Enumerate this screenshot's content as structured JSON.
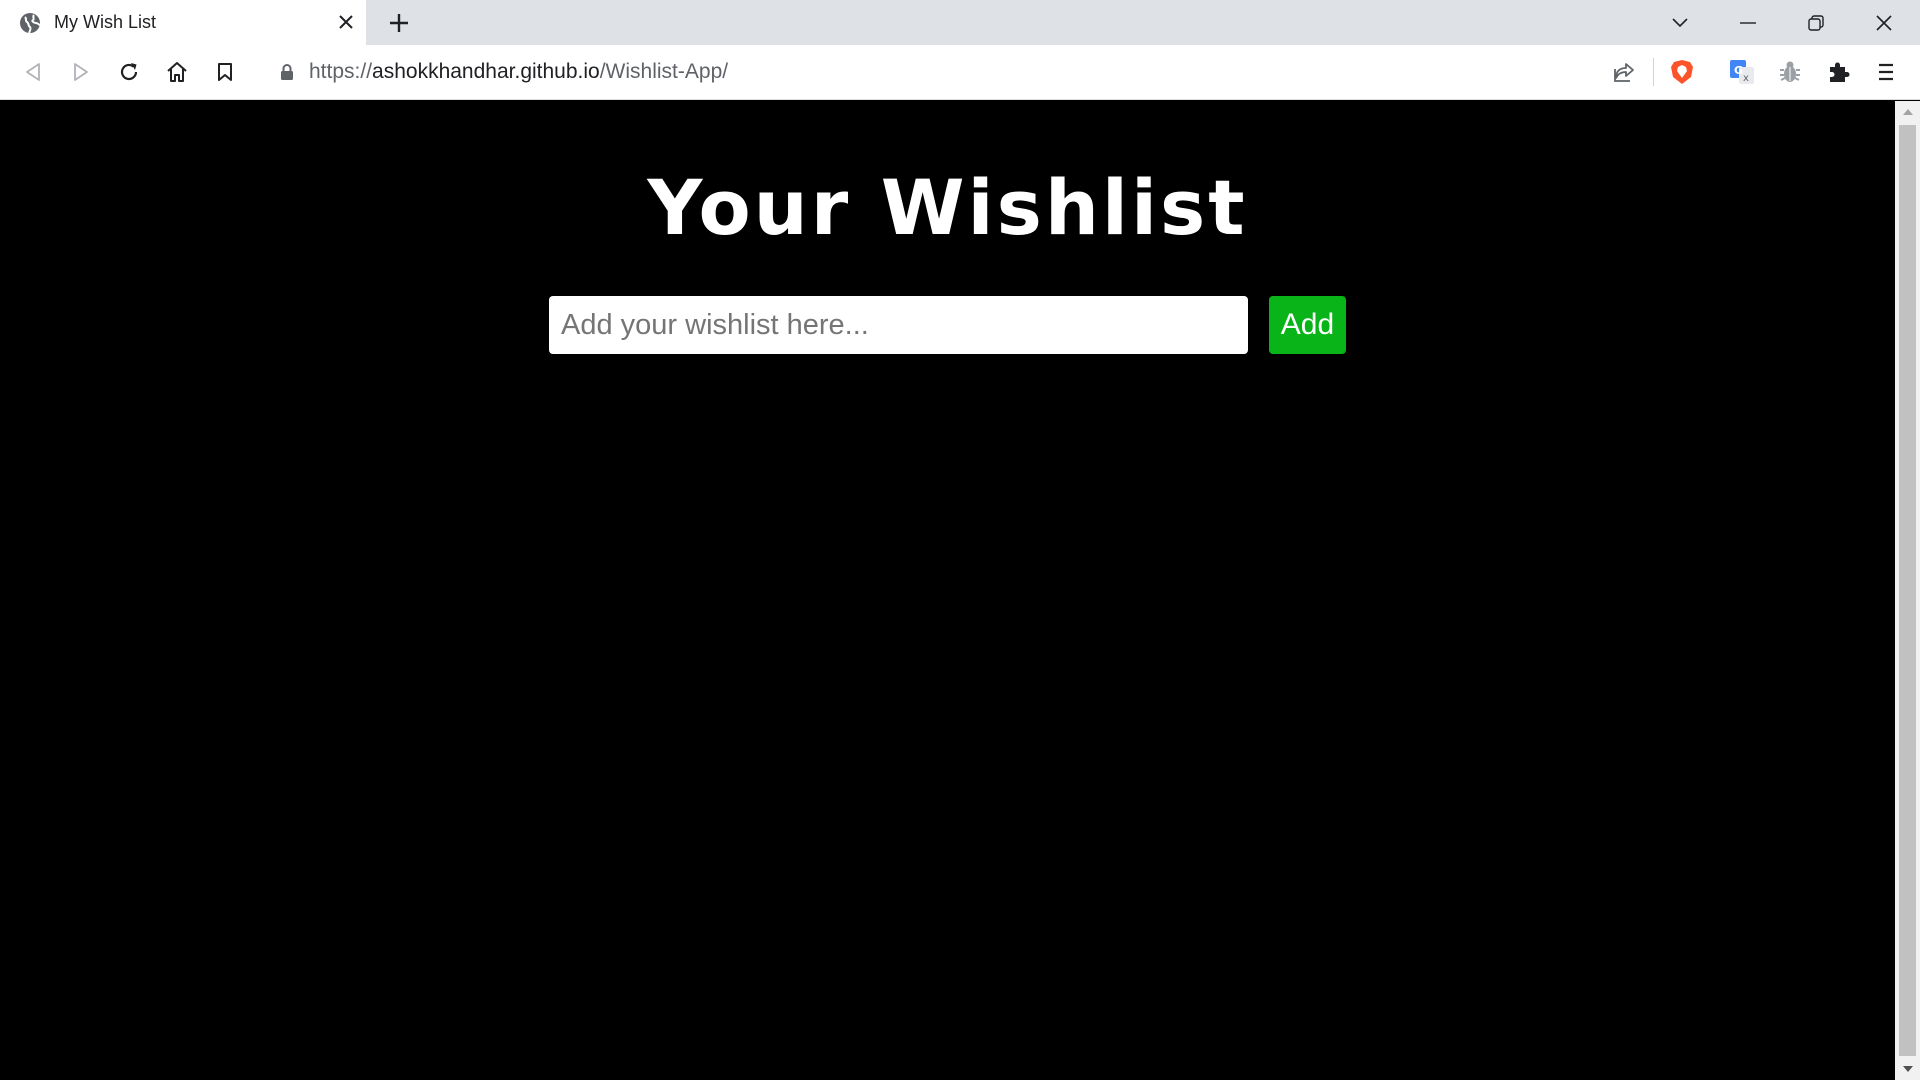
{
  "browser": {
    "tab": {
      "title": "My Wish List",
      "favicon": "globe-icon",
      "close_icon": "close-icon"
    },
    "new_tab_icon": "plus-icon",
    "window_controls": [
      "chevron-down-icon",
      "minimize-icon",
      "restore-icon",
      "close-icon"
    ],
    "toolbar": {
      "back_icon": "back-arrow-icon",
      "forward_icon": "forward-arrow-icon",
      "reload_icon": "reload-icon",
      "home_icon": "home-icon",
      "bookmark_icon": "bookmark-icon",
      "url_scheme": "https://",
      "url_host": "ashokkhandhar.github.io",
      "url_path": "/Wishlist-App/",
      "share_icon": "share-icon",
      "brave_icon": "brave-shield-icon",
      "extensions": [
        "translate-icon",
        "bug-icon",
        "puzzle-icon"
      ],
      "menu_icon": "hamburger-menu-icon"
    }
  },
  "page": {
    "title": "Your Wishlist",
    "input": {
      "placeholder": "Add your wishlist here...",
      "value": ""
    },
    "add_button_label": "Add",
    "colors": {
      "background": "#000000",
      "title": "#ffffff",
      "add_button": "#09b419"
    }
  }
}
